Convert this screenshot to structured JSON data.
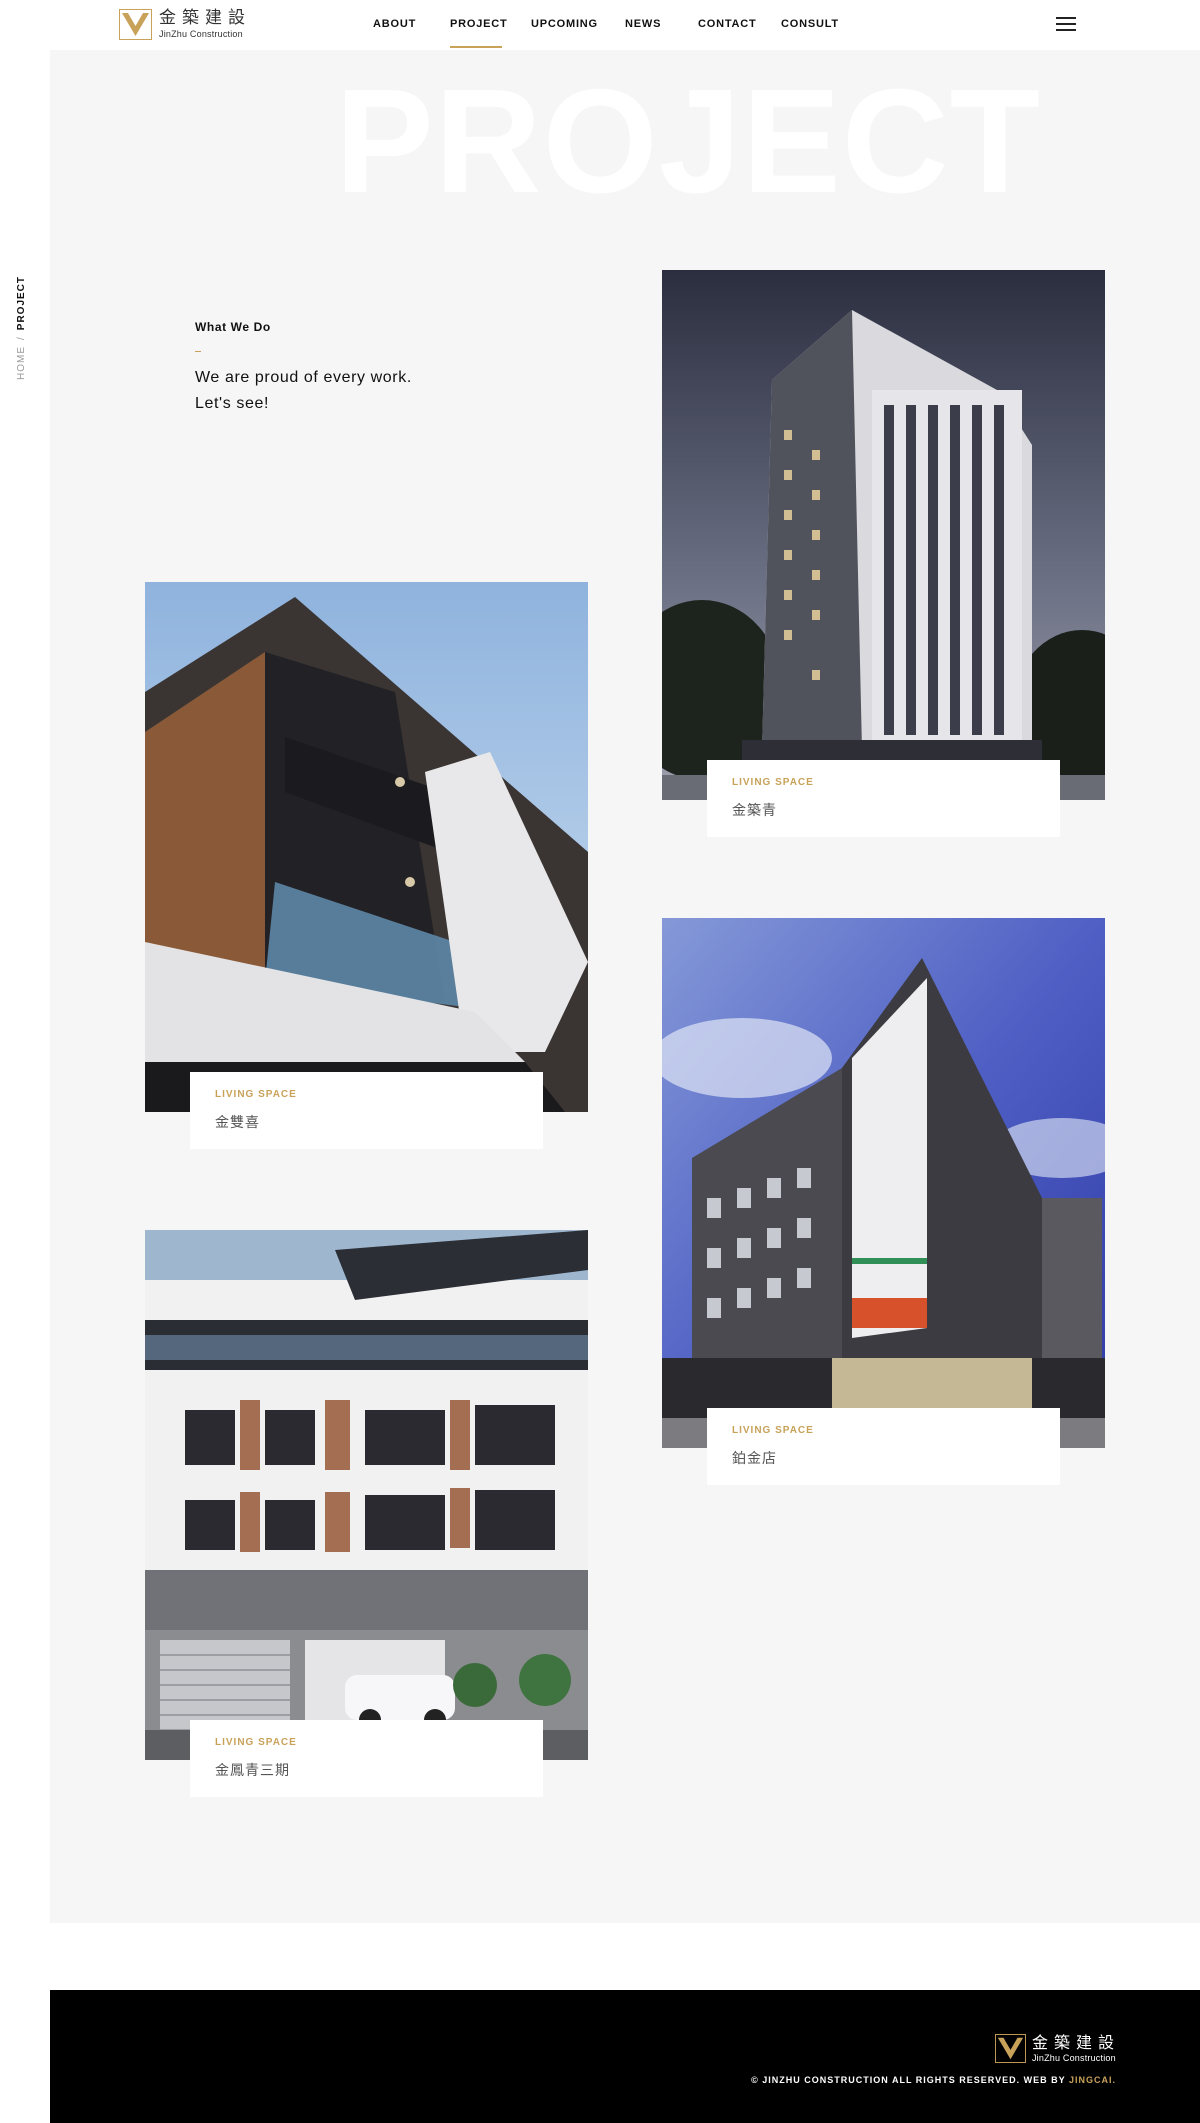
{
  "header": {
    "logo_zh": "金築建設",
    "logo_en": "JinZhu Construction",
    "nav": [
      {
        "label": "ABOUT"
      },
      {
        "label": "PROJECT"
      },
      {
        "label": "UPCOMING"
      },
      {
        "label": "NEWS"
      },
      {
        "label": "CONTACT"
      },
      {
        "label": "CONSULT"
      }
    ],
    "active_nav": "PROJECT",
    "menu_icon": "hamburger-icon"
  },
  "hero": {
    "bg_word": "PROJECT"
  },
  "breadcrumb": {
    "home": "HOME",
    "separator": "/",
    "current": "PROJECT"
  },
  "intro": {
    "label": "What We Do",
    "headline_line1": "We are proud of every work.",
    "headline_line2": "Let's see!"
  },
  "projects": [
    {
      "tag": "LIVING SPACE",
      "title": "金築青"
    },
    {
      "tag": "LIVING SPACE",
      "title": "金雙喜"
    },
    {
      "tag": "LIVING SPACE",
      "title": "鉑金店"
    },
    {
      "tag": "LIVING SPACE",
      "title": "金鳳青三期"
    }
  ],
  "footer": {
    "logo_zh": "金築建設",
    "logo_en": "JinZhu Construction",
    "copyright_prefix": "© JINZHU CONSTRUCTION ALL RIGHTS RESERVED. WEB BY ",
    "copyright_brand": "JINGCAI."
  },
  "colors": {
    "accent": "#c9a25a",
    "panel": "#f6f6f6",
    "footer": "#000000"
  }
}
